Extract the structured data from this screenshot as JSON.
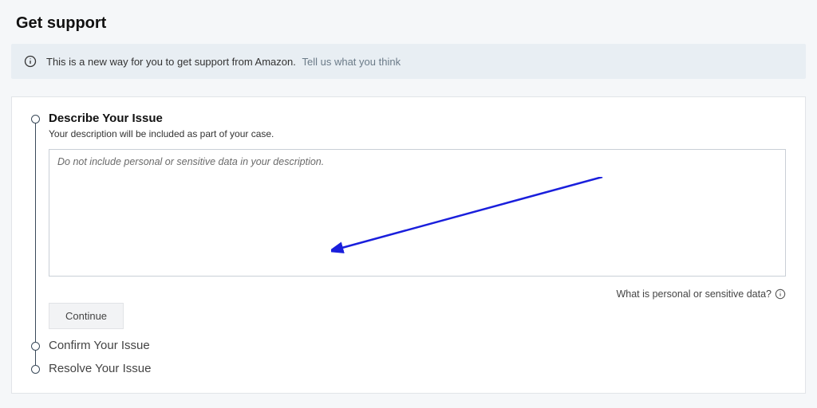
{
  "page": {
    "title": "Get support"
  },
  "banner": {
    "text": "This is a new way for you to get support from Amazon.",
    "link": "Tell us what you think"
  },
  "steps": {
    "describe": {
      "title": "Describe Your Issue",
      "subtitle": "Your description will be included as part of your case.",
      "placeholder": "Do not include personal or sensitive data in your description.",
      "sensitive_link": "What is personal or sensitive data?",
      "continue": "Continue"
    },
    "confirm": {
      "title": "Confirm Your Issue"
    },
    "resolve": {
      "title": "Resolve Your Issue"
    }
  }
}
